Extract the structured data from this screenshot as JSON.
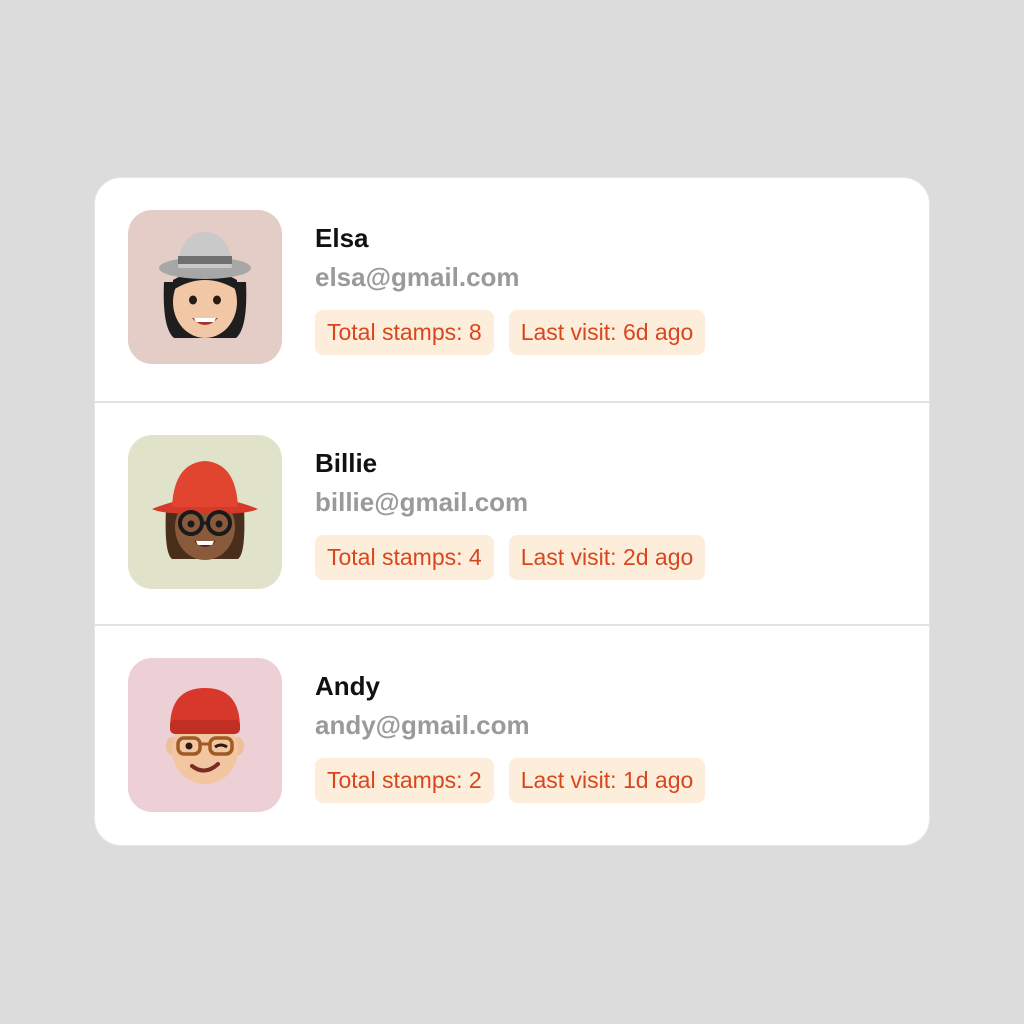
{
  "customers": [
    {
      "name": "Elsa",
      "email": "elsa@gmail.com",
      "stamps_label": "Total stamps: 8",
      "visit_label": "Last visit: 6d ago",
      "avatar_bg": "#e3cdc6",
      "avatar_icon": "memoji-grey-hat"
    },
    {
      "name": "Billie",
      "email": "billie@gmail.com",
      "stamps_label": "Total stamps: 4",
      "visit_label": "Last visit: 2d ago",
      "avatar_bg": "#e0e3c9",
      "avatar_icon": "memoji-red-bucket-hat-glasses"
    },
    {
      "name": "Andy",
      "email": "andy@gmail.com",
      "stamps_label": "Total stamps: 2",
      "visit_label": "Last visit: 1d ago",
      "avatar_bg": "#ecd0d6",
      "avatar_icon": "memoji-red-beanie-winking"
    }
  ],
  "colors": {
    "chip_bg": "#fdeedc",
    "chip_text": "#d9461c",
    "page_bg": "#dcdcdc"
  }
}
